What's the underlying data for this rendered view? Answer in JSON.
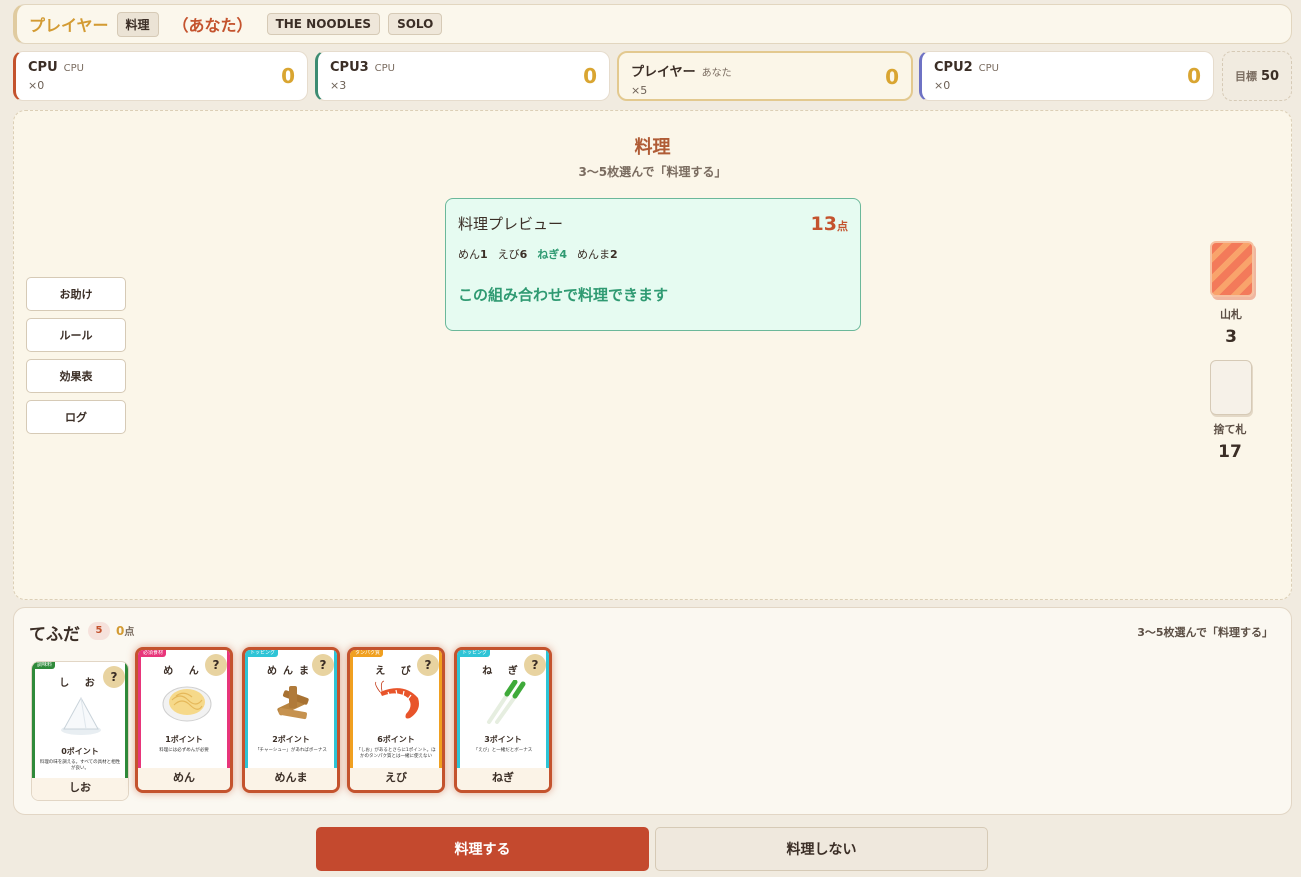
{
  "header": {
    "player_name": "プレイヤー",
    "phase_chip": "料理",
    "you_label": "（あなた）",
    "game_chip": "THE NOODLES",
    "mode_chip": "SOLO"
  },
  "players": [
    {
      "name": "CPU",
      "type": "CPU",
      "count": "×0",
      "score": "0",
      "color": "#c4532e"
    },
    {
      "name": "CPU3",
      "type": "CPU",
      "count": "×3",
      "score": "0",
      "color": "#3d8c72"
    },
    {
      "name": "プレイヤー",
      "type": "あなた",
      "count": "×5",
      "score": "0",
      "color": "#e3c98f"
    },
    {
      "name": "CPU2",
      "type": "CPU",
      "count": "×0",
      "score": "0",
      "color": "#6e72c4"
    }
  ],
  "goal": {
    "label": "目標",
    "value": "50"
  },
  "board": {
    "phase_title": "料理",
    "phase_sub": "3〜5枚選んで「料理する」",
    "preview": {
      "title": "料理プレビュー",
      "points": "13",
      "points_unit": "点",
      "combo": [
        {
          "name": "めん",
          "num": "1"
        },
        {
          "name": "えび",
          "num": "6"
        },
        {
          "name": "ねぎ",
          "num": "4"
        },
        {
          "name": "めんま",
          "num": "2"
        }
      ],
      "message": "この組み合わせで料理できます"
    }
  },
  "side_buttons": [
    "お助け",
    "ルール",
    "効果表",
    "ログ"
  ],
  "piles": {
    "deck_label": "山札",
    "deck_count": "3",
    "discard_label": "捨て札",
    "discard_count": "17"
  },
  "hand": {
    "title": "てふだ",
    "count": "5",
    "points": "0",
    "points_unit": "点",
    "note": "3〜5枚選んで「料理する」",
    "cards": [
      {
        "name": "し お",
        "tag": "調味料",
        "points": "0ポイント",
        "desc": "料理の味を調える。すべての具材と相性が良い。",
        "footer": "しお",
        "color": "#2f8a3a",
        "selected": false
      },
      {
        "name": "め ん",
        "tag": "必須食材",
        "points": "1ポイント",
        "desc": "料理には必ずめんが必要",
        "footer": "めん",
        "color": "#e8357a",
        "selected": true
      },
      {
        "name": "めんま",
        "tag": "トッピング",
        "points": "2ポイント",
        "desc": "「チャーシュー」があればボーナス",
        "footer": "めんま",
        "color": "#2ec4d6",
        "selected": true
      },
      {
        "name": "え び",
        "tag": "タンパク質",
        "points": "6ポイント",
        "desc": "「しお」があるとさらに1ポイント。ほかのタンパク質とは一緒に使えない",
        "footer": "えび",
        "color": "#f0a020",
        "selected": true
      },
      {
        "name": "ね ぎ",
        "tag": "トッピング",
        "points": "3ポイント",
        "desc": "「えび」と一緒だとボーナス",
        "footer": "ねぎ",
        "color": "#2ec4d6",
        "selected": true
      }
    ],
    "question_mark": "?"
  },
  "actions": {
    "cook": "料理する",
    "skip": "料理しない"
  }
}
